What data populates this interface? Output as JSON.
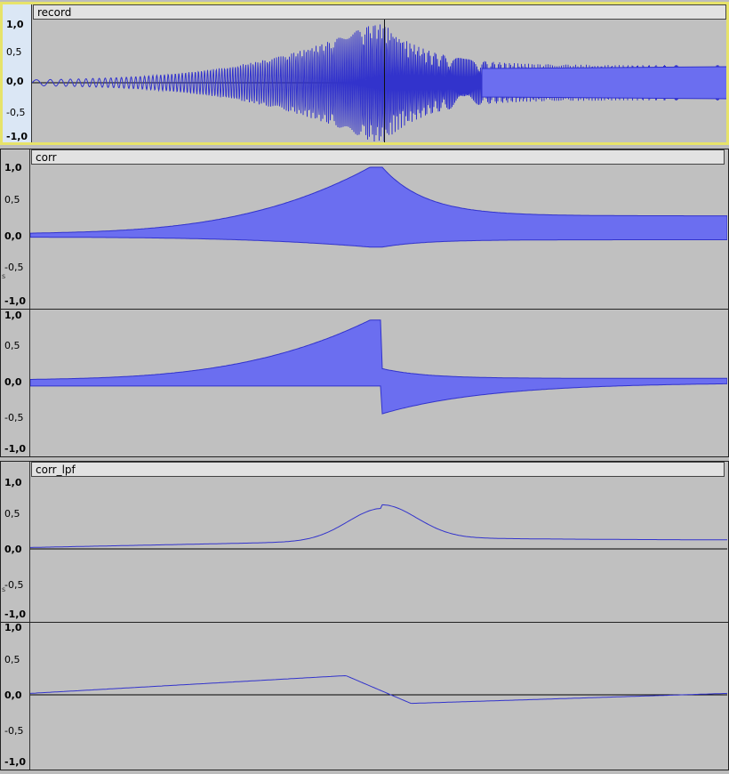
{
  "tracks": [
    {
      "name": "record",
      "channels": 1,
      "selected": true
    },
    {
      "name": "corr",
      "channels": 2,
      "selected": false
    },
    {
      "name": "corr_lpf",
      "channels": 2,
      "selected": false
    }
  ],
  "ruler": {
    "labels": [
      "1,0",
      "0,5",
      "0,0",
      "-0,5",
      "-1,0"
    ]
  },
  "side_mark": "s",
  "colors": {
    "wave": "#3233cc",
    "wave_rms": "#6b6ef0",
    "background": "#c0c0c0",
    "selection_border": "#e7e36a"
  }
}
